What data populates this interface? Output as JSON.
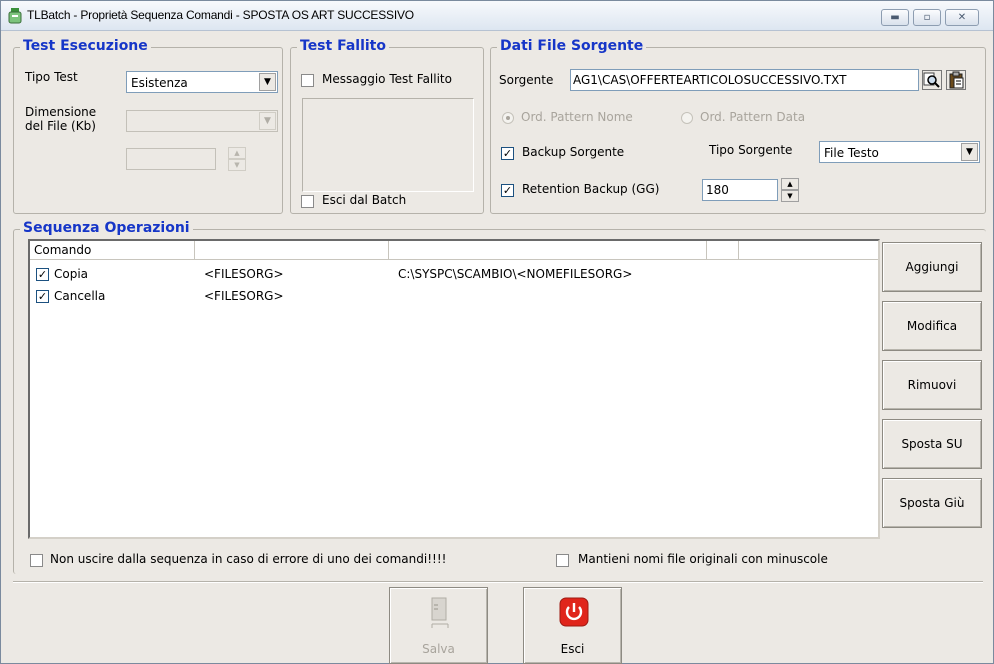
{
  "window": {
    "title": "TLBatch - Proprietà Sequenza Comandi - SPOSTA OS ART SUCCESSIVO",
    "controls": [
      "minimize-icon",
      "maximize-icon",
      "close-icon"
    ]
  },
  "test_esecuzione": {
    "legend": "Test Esecuzione",
    "tipo_test_label": "Tipo Test",
    "tipo_test_value": "Esistenza",
    "dimensione_label_1": "Dimensione",
    "dimensione_label_2": "del File (Kb)",
    "dimensione_value": "",
    "spin_value": ""
  },
  "test_fallito": {
    "legend": "Test Fallito",
    "messaggio_label": "Messaggio Test Fallito",
    "messaggio_checked": false,
    "esci_label": "Esci dal Batch",
    "esci_checked": false
  },
  "dati_file": {
    "legend": "Dati File Sorgente",
    "sorgente_label": "Sorgente",
    "sorgente_value": "AG1\\CAS\\OFFERTEARTICOLOSUCCESSIVO.TXT",
    "ord_nome_label": "Ord. Pattern Nome",
    "ord_data_label": "Ord. Pattern Data",
    "backup_label": "Backup Sorgente",
    "backup_checked": true,
    "tipo_sorgente_label": "Tipo Sorgente",
    "tipo_sorgente_value": "File Testo",
    "retention_label": "Retention Backup (GG)",
    "retention_checked": true,
    "retention_value": "180"
  },
  "sequenza": {
    "legend": "Sequenza Operazioni",
    "columns": [
      "Comando",
      "",
      "",
      "",
      ""
    ],
    "rows": [
      {
        "checked": true,
        "comando": "Copia",
        "arg1": "<FILESORG>",
        "arg2": "C:\\SYSPC\\SCAMBIO\\<NOMEFILESORG>"
      },
      {
        "checked": true,
        "comando": "Cancella",
        "arg1": "<FILESORG>",
        "arg2": ""
      }
    ]
  },
  "side_buttons": {
    "aggiungi": "Aggiungi",
    "modifica": "Modifica",
    "rimuovi": "Rimuovi",
    "sposta_su": "Sposta SU",
    "sposta_giu": "Sposta Giù"
  },
  "options": {
    "non_uscire_label": "Non uscire dalla sequenza in caso di errore di uno dei comandi!!!!",
    "non_uscire_checked": false,
    "mantieni_label": "Mantieni nomi file originali con minuscole",
    "mantieni_checked": false
  },
  "footer": {
    "salva_label": "Salva",
    "esci_label": "Esci"
  },
  "colors": {
    "legend": "#1636c8",
    "window_bg": "#ece9e4",
    "esci_icon": "#e0251b"
  }
}
